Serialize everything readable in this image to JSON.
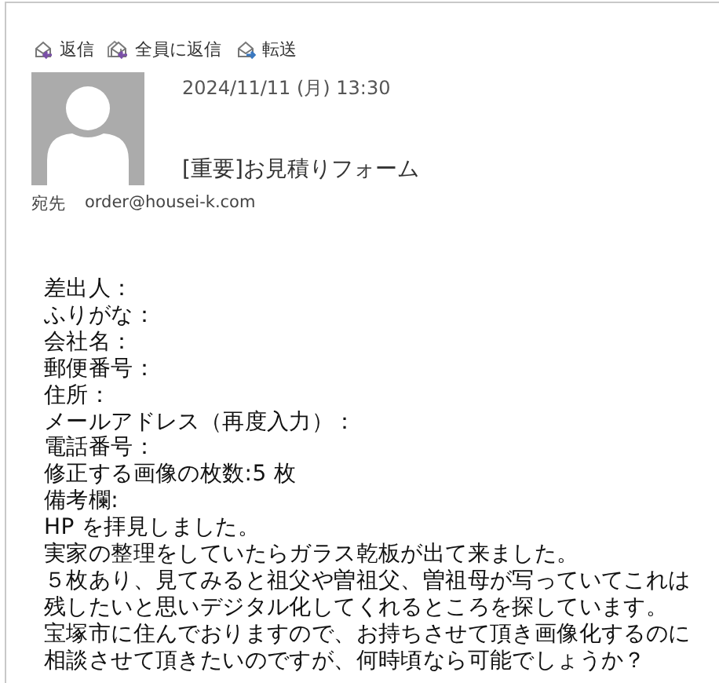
{
  "toolbar": [
    {
      "kind": "reply",
      "label": "返信"
    },
    {
      "kind": "reply-all",
      "label": "全員に返信"
    },
    {
      "kind": "forward",
      "label": "転送"
    }
  ],
  "message": {
    "date": "2024/11/11 (月) 13:30",
    "subject": "[重要]お見積りフォーム",
    "to_label": "宛先",
    "to": "order@housei-k.com"
  },
  "body": [
    "差出人：",
    "ふりがな：",
    "会社名：",
    "郵便番号：",
    "住所：",
    "メールアドレス（再度入力）：",
    "電話番号：",
    "修正する画像の枚数:5 枚",
    "備考欄:",
    "HP を拝見しました。",
    "実家の整理をしていたらガラス乾板が出て来ました。",
    "５枚あり、見てみると祖父や曽祖父、曽祖母が写っていてこれは",
    "残したいと思いデジタル化してくれるところを探しています。",
    "宝塚市に住んでおりますので、お持ちさせて頂き画像化するのに",
    "相談させて頂きたいのですが、何時頃なら可能でしょうか？"
  ]
}
